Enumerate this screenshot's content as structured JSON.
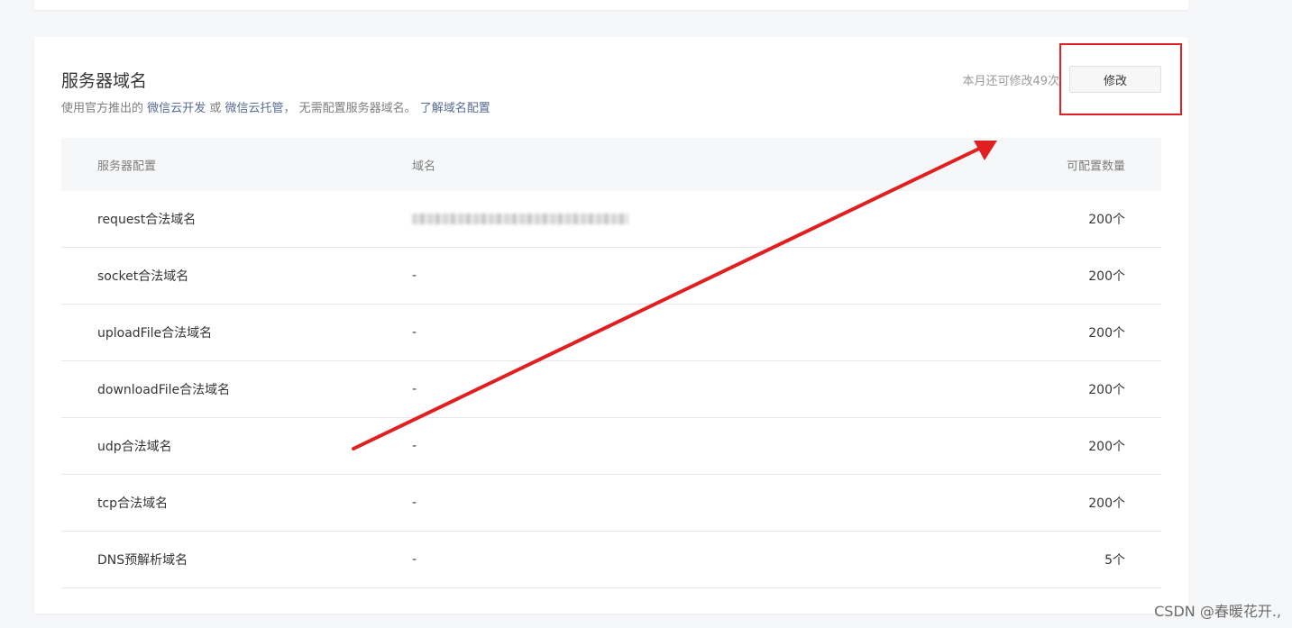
{
  "section": {
    "title": "服务器域名",
    "desc_prefix": "使用官方推出的",
    "link_cloud_dev": "微信云开发",
    "desc_or": "或",
    "link_cloud_host": "微信云托管",
    "desc_suffix": "， 无需配置服务器域名。",
    "link_learn": "了解域名配置",
    "quota_text": "本月还可修改49次",
    "modify_label": "修改"
  },
  "table": {
    "headers": [
      "服务器配置",
      "域名",
      "可配置数量"
    ],
    "rows": [
      {
        "name": "request合法域名",
        "domain": "",
        "count": "200个"
      },
      {
        "name": "socket合法域名",
        "domain": "-",
        "count": "200个"
      },
      {
        "name": "uploadFile合法域名",
        "domain": "-",
        "count": "200个"
      },
      {
        "name": "downloadFile合法域名",
        "domain": "-",
        "count": "200个"
      },
      {
        "name": "udp合法域名",
        "domain": "-",
        "count": "200个"
      },
      {
        "name": "tcp合法域名",
        "domain": "-",
        "count": "200个"
      },
      {
        "name": "DNS预解析域名",
        "domain": "-",
        "count": "5个"
      }
    ]
  },
  "annotation": {
    "color": "#e02020"
  },
  "watermark": "CSDN @春暖花开.,",
  "colors": {
    "link": "#576b95",
    "background": "#f6f7f9",
    "card": "#ffffff"
  }
}
